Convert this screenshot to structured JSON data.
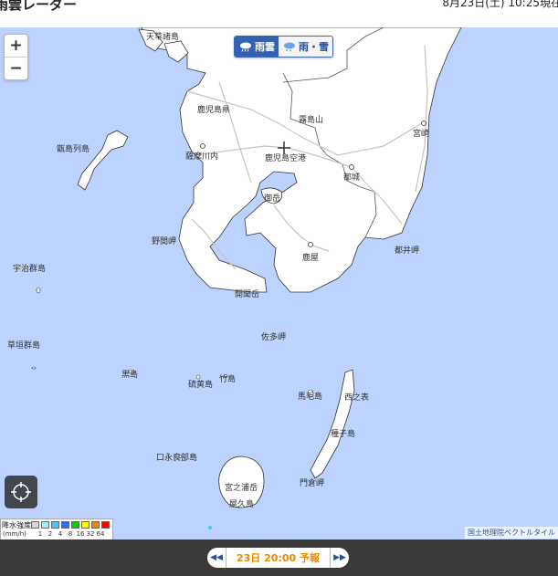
{
  "header": {
    "title": "雨雲レーダー",
    "timestamp": "8月23日(土) 10:25現在"
  },
  "map": {
    "labels": {
      "yakushima_a": "屋久島",
      "amakusa": "天草諸島",
      "kagoshima_pref": "鹿児島県",
      "kirishima": "霧島山",
      "miyazaki": "宮崎",
      "koshiki": "甑島列島",
      "satsumasendai": "薩摩川内",
      "airport": "鹿児島空港",
      "miyakonojo": "都城",
      "sakurajima": "御岳",
      "toi": "都井岬",
      "nomamisaki": "野間岬",
      "kanoya": "鹿屋",
      "uji": "宇治群島",
      "kaimondake": "開聞岳",
      "satamisaki": "佐多岬",
      "kusagaki": "草垣群島",
      "kuroshima": "黒島",
      "iojima": "硫黄島",
      "takeshima": "竹島",
      "mageshima": "馬毛島",
      "nishinoomote": "西之表",
      "tanegashima": "種子島",
      "kuchinoerabu": "口永良部島",
      "miyanouradake": "宮之浦岳",
      "yakushima": "屋久島",
      "kadokura": "門倉岬"
    }
  },
  "controls": {
    "zoom_in": "+",
    "zoom_out": "−",
    "mode_rain": "雨雲",
    "mode_snow": "雨・雪",
    "locate": "locate-icon"
  },
  "legend": {
    "title": "降水強度",
    "unit": "(mm/h)",
    "ticks": [
      "1",
      "2",
      "4",
      "8",
      "16",
      "32",
      "64"
    ],
    "colors": [
      "#d8d8d8",
      "#a0f0ff",
      "#40c8ff",
      "#2a6dff",
      "#00d000",
      "#ffff00",
      "#ff8000",
      "#ff0000"
    ]
  },
  "attribution": "国土地理院ベクトルタイル",
  "timebar": {
    "label": "23日 20:00 予報"
  },
  "colors": {
    "sea": "#bcd2ff",
    "land": "#ffffff",
    "footer": "#3a3a3a",
    "accent": "#3461b4",
    "forecast": "#e88a00"
  }
}
